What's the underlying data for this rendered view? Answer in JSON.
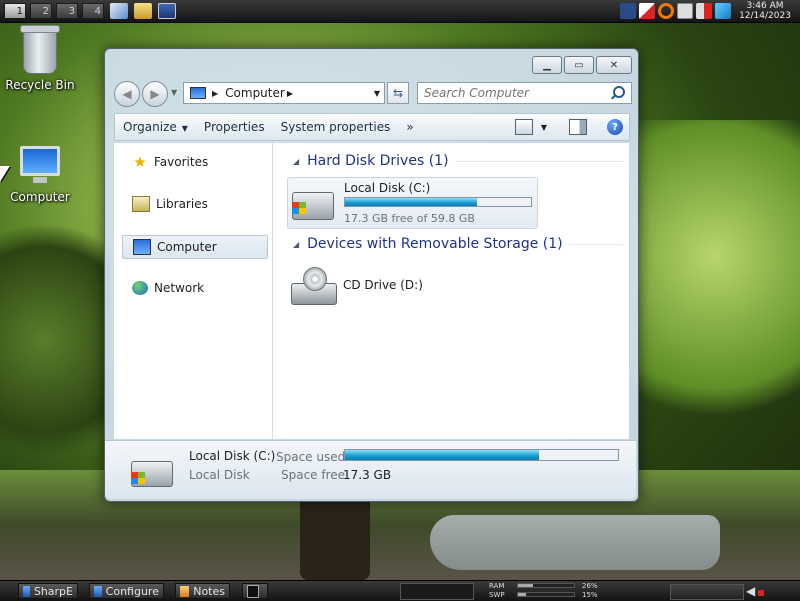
{
  "top_panel": {
    "workspaces": [
      "1",
      "2",
      "3",
      "4"
    ],
    "clock": {
      "time": "3:46 AM",
      "date": "12/14/2023"
    }
  },
  "desktop": {
    "recycle_bin_label": "Recycle Bin",
    "computer_label": "Computer"
  },
  "window": {
    "controls": {
      "minimize": "▁",
      "maximize": "▭",
      "close": "✕"
    },
    "address": {
      "location": "Computer"
    },
    "search": {
      "placeholder": "Search Computer"
    },
    "toolbar": {
      "organize": "Organize",
      "system_properties": "System properties",
      "properties": "Properties",
      "more": "»"
    },
    "nav_pane": {
      "favorites": "Favorites",
      "libraries": "Libraries",
      "computer": "Computer",
      "network": "Network"
    },
    "groups": {
      "hard_disks": "Hard Disk Drives (1)",
      "removable": "Devices with Removable Storage (1)"
    },
    "local_disk": {
      "name": "Local Disk (C:)",
      "free_text": "17.3 GB free of 59.8 GB",
      "used_fraction": 0.71
    },
    "cd_drive": {
      "name": "CD Drive (D:)"
    },
    "details": {
      "name": "Local Disk (C:)",
      "type": "Local Disk",
      "space_used_label": "Space used:",
      "space_free_label": "Space free:",
      "space_free_value": "17.3 GB",
      "used_fraction": 0.71
    }
  },
  "bottom_panel": {
    "tasks": {
      "sharpe": "SharpE",
      "configure": "Configure",
      "notes": "Notes"
    },
    "ram_label": "RAM",
    "swap_label": "SWP",
    "ram_value": "26%",
    "swap_value": "15%",
    "ram_fraction": 0.26,
    "swap_fraction": 0.15
  },
  "colors": {
    "accent": "#1e3287",
    "bar_fill": "#1aa0d4"
  }
}
